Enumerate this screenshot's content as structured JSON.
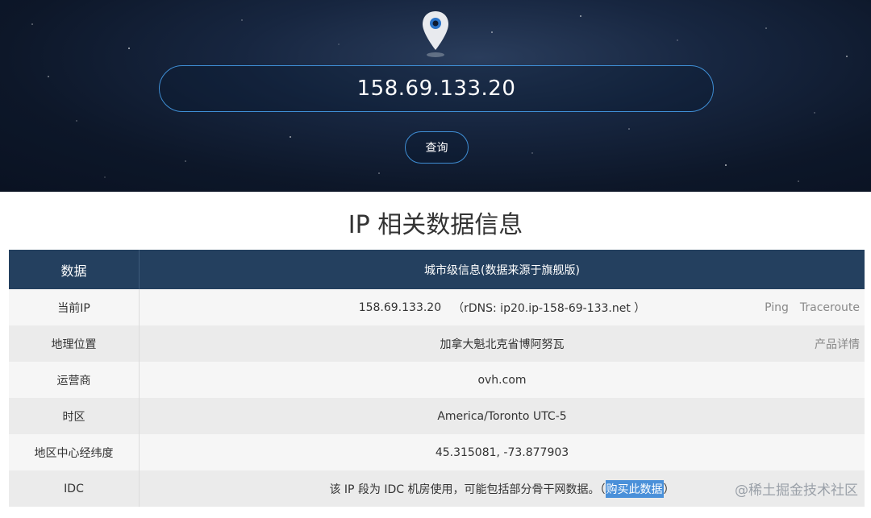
{
  "search": {
    "ip_value": "158.69.133.20",
    "button_label": "查询"
  },
  "section_title": "IP 相关数据信息",
  "table": {
    "header": {
      "col1": "数据",
      "col2": "城市级信息(数据来源于旗舰版)"
    },
    "rows": [
      {
        "label": "当前IP",
        "value": "158.69.133.20",
        "rdns": "（rDNS: ip20.ip-158-69-133.net ）",
        "links": [
          "Ping",
          "Traceroute"
        ]
      },
      {
        "label": "地理位置",
        "value": "加拿大魁北克省博阿努瓦",
        "link": "产品详情"
      },
      {
        "label": "运营商",
        "value": "ovh.com"
      },
      {
        "label": "时区",
        "value": "America/Toronto UTC-5"
      },
      {
        "label": "地区中心经纬度",
        "value": "45.315081, -73.877903"
      },
      {
        "label": "IDC",
        "value_prefix": "该 IP 段为 IDC 机房使用，可能包括部分骨干网数据。（",
        "buy_link": "购买此数据",
        "value_suffix": "）",
        "watermark": "@稀土掘金技术社区"
      }
    ]
  },
  "colors": {
    "header_bg": "#24405f",
    "accent_border": "#3f8fd6",
    "buy_highlight": "#4a90d9"
  }
}
